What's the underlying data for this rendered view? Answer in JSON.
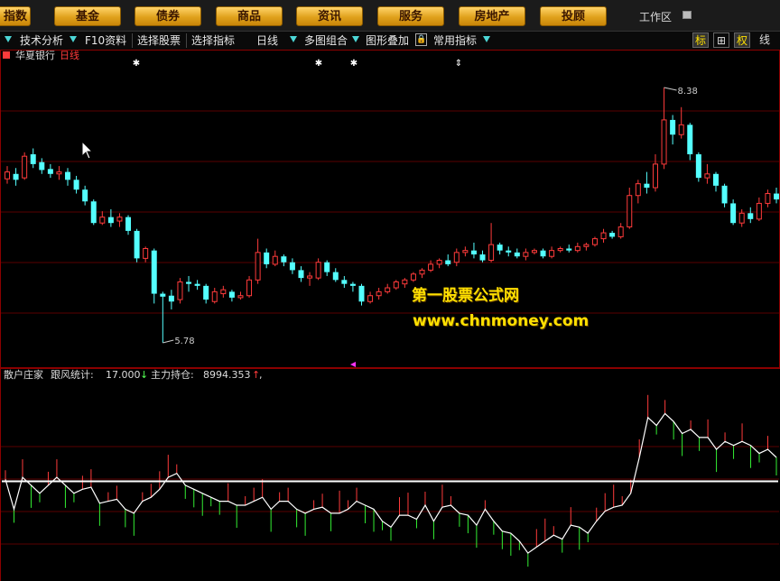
{
  "nav": {
    "items": [
      "指数",
      "基金",
      "债券",
      "商品",
      "资讯",
      "服务",
      "房地产",
      "投顾"
    ],
    "workspace": "工作区"
  },
  "toolbar": {
    "tech": "技术分析",
    "f10": "F10资料",
    "pick_stock": "选择股票",
    "pick_indicator": "选择指标",
    "period": "日线",
    "multi": "多图组合",
    "overlay": "图形叠加",
    "common": "常用指标",
    "right": [
      "标",
      "⊞",
      "权",
      "线"
    ]
  },
  "main_chart": {
    "stock_name": "华夏银行",
    "period": "日线",
    "high_label": "8.38",
    "low_label": "5.78",
    "y_range": [
      5.55,
      8.72
    ],
    "candles": [
      [
        7.45,
        7.52,
        7.4,
        7.58
      ],
      [
        7.5,
        7.44,
        7.38,
        7.56
      ],
      [
        7.46,
        7.68,
        7.44,
        7.72
      ],
      [
        7.7,
        7.6,
        7.56,
        7.76
      ],
      [
        7.62,
        7.54,
        7.5,
        7.66
      ],
      [
        7.55,
        7.5,
        7.46,
        7.6
      ],
      [
        7.5,
        7.52,
        7.44,
        7.58
      ],
      [
        7.52,
        7.44,
        7.38,
        7.56
      ],
      [
        7.44,
        7.34,
        7.3,
        7.48
      ],
      [
        7.34,
        7.22,
        7.18,
        7.38
      ],
      [
        7.22,
        7.0,
        6.98,
        7.24
      ],
      [
        7.0,
        7.06,
        6.98,
        7.12
      ],
      [
        7.06,
        7.0,
        6.96,
        7.14
      ],
      [
        7.02,
        7.06,
        6.96,
        7.1
      ],
      [
        7.06,
        6.92,
        6.88,
        7.08
      ],
      [
        6.92,
        6.64,
        6.6,
        6.94
      ],
      [
        6.64,
        6.74,
        6.6,
        6.76
      ],
      [
        6.72,
        6.28,
        6.18,
        6.74
      ],
      [
        6.28,
        6.25,
        5.78,
        6.3
      ],
      [
        6.26,
        6.2,
        6.12,
        6.32
      ],
      [
        6.22,
        6.4,
        6.18,
        6.44
      ],
      [
        6.4,
        6.38,
        6.3,
        6.46
      ],
      [
        6.38,
        6.36,
        6.32,
        6.42
      ],
      [
        6.36,
        6.22,
        6.18,
        6.38
      ],
      [
        6.2,
        6.3,
        6.18,
        6.34
      ],
      [
        6.28,
        6.32,
        6.24,
        6.36
      ],
      [
        6.3,
        6.24,
        6.2,
        6.32
      ],
      [
        6.24,
        6.26,
        6.22,
        6.3
      ],
      [
        6.26,
        6.42,
        6.24,
        6.46
      ],
      [
        6.42,
        6.7,
        6.38,
        6.84
      ],
      [
        6.7,
        6.58,
        6.54,
        6.74
      ],
      [
        6.58,
        6.66,
        6.56,
        6.72
      ],
      [
        6.66,
        6.6,
        6.56,
        6.68
      ],
      [
        6.6,
        6.52,
        6.48,
        6.64
      ],
      [
        6.52,
        6.44,
        6.4,
        6.56
      ],
      [
        6.44,
        6.46,
        6.36,
        6.5
      ],
      [
        6.44,
        6.6,
        6.42,
        6.64
      ],
      [
        6.6,
        6.5,
        6.46,
        6.62
      ],
      [
        6.5,
        6.42,
        6.4,
        6.54
      ],
      [
        6.42,
        6.38,
        6.34,
        6.46
      ],
      [
        6.38,
        6.36,
        6.3,
        6.4
      ],
      [
        6.36,
        6.2,
        6.16,
        6.38
      ],
      [
        6.2,
        6.26,
        6.18,
        6.3
      ],
      [
        6.26,
        6.3,
        6.22,
        6.34
      ],
      [
        6.3,
        6.34,
        6.28,
        6.38
      ],
      [
        6.34,
        6.4,
        6.32,
        6.42
      ],
      [
        6.38,
        6.42,
        6.34,
        6.44
      ],
      [
        6.42,
        6.48,
        6.4,
        6.5
      ],
      [
        6.48,
        6.52,
        6.44,
        6.54
      ],
      [
        6.52,
        6.58,
        6.5,
        6.62
      ],
      [
        6.58,
        6.62,
        6.54,
        6.64
      ],
      [
        6.62,
        6.58,
        6.56,
        6.68
      ],
      [
        6.6,
        6.7,
        6.56,
        6.74
      ],
      [
        6.7,
        6.72,
        6.66,
        6.76
      ],
      [
        6.72,
        6.68,
        6.64,
        6.8
      ],
      [
        6.68,
        6.62,
        6.6,
        6.72
      ],
      [
        6.62,
        6.78,
        6.6,
        7.0
      ],
      [
        6.78,
        6.72,
        6.68,
        6.8
      ],
      [
        6.72,
        6.7,
        6.66,
        6.76
      ],
      [
        6.7,
        6.66,
        6.64,
        6.74
      ],
      [
        6.66,
        6.7,
        6.62,
        6.74
      ],
      [
        6.7,
        6.72,
        6.68,
        6.74
      ],
      [
        6.72,
        6.66,
        6.64,
        6.74
      ],
      [
        6.66,
        6.72,
        6.64,
        6.76
      ],
      [
        6.72,
        6.74,
        6.7,
        6.76
      ],
      [
        6.74,
        6.72,
        6.7,
        6.78
      ],
      [
        6.72,
        6.76,
        6.7,
        6.8
      ],
      [
        6.76,
        6.78,
        6.72,
        6.8
      ],
      [
        6.78,
        6.84,
        6.76,
        6.86
      ],
      [
        6.84,
        6.9,
        6.8,
        6.94
      ],
      [
        6.9,
        6.86,
        6.84,
        6.92
      ],
      [
        6.86,
        6.96,
        6.84,
        7.0
      ],
      [
        6.96,
        7.28,
        6.94,
        7.36
      ],
      [
        7.28,
        7.4,
        7.2,
        7.44
      ],
      [
        7.4,
        7.36,
        7.3,
        7.52
      ],
      [
        7.36,
        7.6,
        7.32,
        7.7
      ],
      [
        7.6,
        8.05,
        7.55,
        8.38
      ],
      [
        8.05,
        7.9,
        7.8,
        8.1
      ],
      [
        7.9,
        8.0,
        7.86,
        8.18
      ],
      [
        8.0,
        7.7,
        7.64,
        8.02
      ],
      [
        7.7,
        7.46,
        7.42,
        7.72
      ],
      [
        7.46,
        7.5,
        7.4,
        7.6
      ],
      [
        7.5,
        7.38,
        7.32,
        7.52
      ],
      [
        7.38,
        7.2,
        7.16,
        7.4
      ],
      [
        7.2,
        7.0,
        6.98,
        7.24
      ],
      [
        7.0,
        7.1,
        6.96,
        7.14
      ],
      [
        7.1,
        7.04,
        7.0,
        7.16
      ],
      [
        7.04,
        7.2,
        7.02,
        7.26
      ],
      [
        7.2,
        7.3,
        7.16,
        7.34
      ],
      [
        7.3,
        7.24,
        7.2,
        7.36
      ]
    ]
  },
  "indicator": {
    "name": "散户庄家",
    "stat1_label": "跟风统计:",
    "stat1_value": "17.000",
    "stat1_arrow": "↓",
    "stat2_label": "主力持仓:",
    "stat2_value": "8994.353",
    "stat2_arrow": "↑",
    "threshold": 50,
    "y_range": [
      0,
      100
    ],
    "values": [
      51,
      36,
      52,
      48,
      44,
      48,
      52,
      48,
      44,
      46,
      47,
      39,
      40,
      41,
      36,
      34,
      40,
      42,
      46,
      52,
      54,
      48,
      46,
      44,
      42,
      40,
      40,
      38,
      38,
      40,
      42,
      36,
      40,
      40,
      36,
      34,
      36,
      37,
      34,
      34,
      36,
      40,
      38,
      36,
      30,
      27,
      33,
      33,
      31,
      38,
      30,
      37,
      38,
      34,
      33,
      28,
      36,
      30,
      25,
      24,
      20,
      14,
      17,
      20,
      23,
      21,
      28,
      27,
      24,
      30,
      35,
      37,
      38,
      44,
      62,
      82,
      78,
      84,
      80,
      74,
      76,
      72,
      72,
      66,
      70,
      68,
      70,
      68,
      64,
      66,
      62
    ]
  },
  "watermark": {
    "site_name": "第一股票公式网",
    "url": "www.chnmoney.com"
  },
  "colors": {
    "up": "#ff3b3b",
    "down": "#54ffff",
    "nav_bg": "#e0a21c",
    "watermark": "#ffe000",
    "indicator_line": "#ffffff"
  }
}
